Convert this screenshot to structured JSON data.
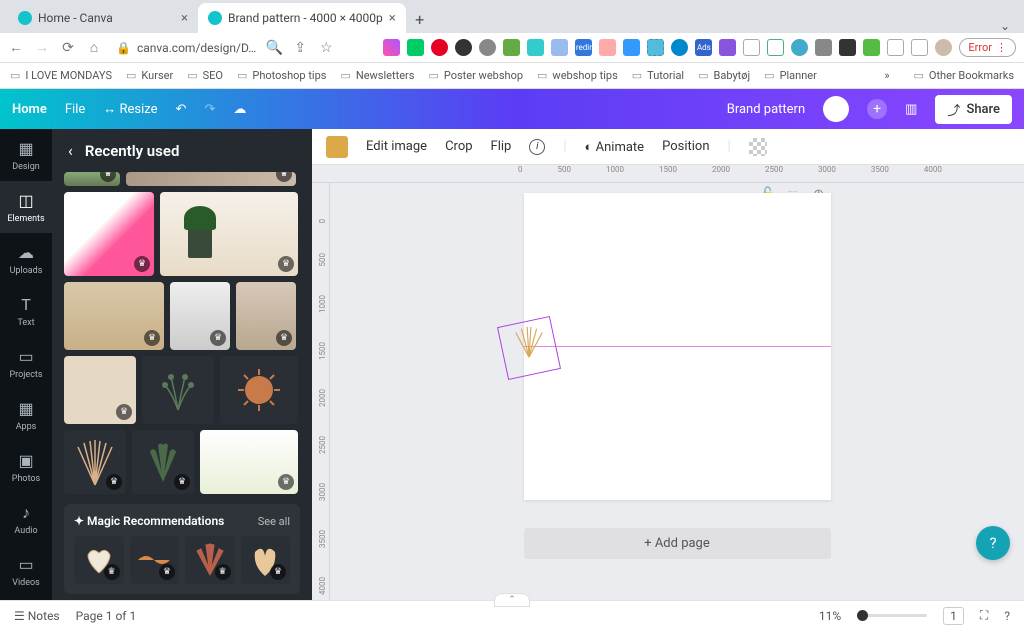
{
  "browser": {
    "tabs": [
      {
        "title": "Home - Canva"
      },
      {
        "title": "Brand pattern - 4000 × 4000p"
      }
    ],
    "url": "canva.com/design/D…",
    "error_label": "Error",
    "bookmarks": [
      "I LOVE MONDAYS",
      "Kurser",
      "SEO",
      "Photoshop tips",
      "Newsletters",
      "Poster webshop",
      "webshop tips",
      "Tutorial",
      "Babytøj",
      "Planner"
    ],
    "bookmarks_more": "»",
    "other_bookmarks": "Other Bookmarks"
  },
  "canva_bar": {
    "home": "Home",
    "file": "File",
    "resize": "Resize",
    "title": "Brand pattern",
    "share": "Share"
  },
  "toolbar": {
    "edit_image": "Edit image",
    "crop": "Crop",
    "flip": "Flip",
    "animate": "Animate",
    "position": "Position"
  },
  "sidebar_nav": [
    "Design",
    "Elements",
    "Uploads",
    "Text",
    "Projects",
    "Apps",
    "Photos",
    "Audio",
    "Videos"
  ],
  "panel": {
    "title": "Recently used",
    "magic_title": "Magic Recommendations",
    "see_all": "See all"
  },
  "ruler_h": [
    "0",
    "500",
    "1000",
    "1500",
    "2000",
    "2500",
    "3000",
    "3500",
    "4000"
  ],
  "ruler_v": [
    "0",
    "500",
    "1000",
    "1500",
    "2000",
    "2500",
    "3000",
    "3500",
    "4000"
  ],
  "canvas": {
    "add_page": "+ Add page"
  },
  "bottom": {
    "notes": "Notes",
    "page": "Page 1 of 1",
    "zoom": "11%",
    "page_num": "1"
  }
}
